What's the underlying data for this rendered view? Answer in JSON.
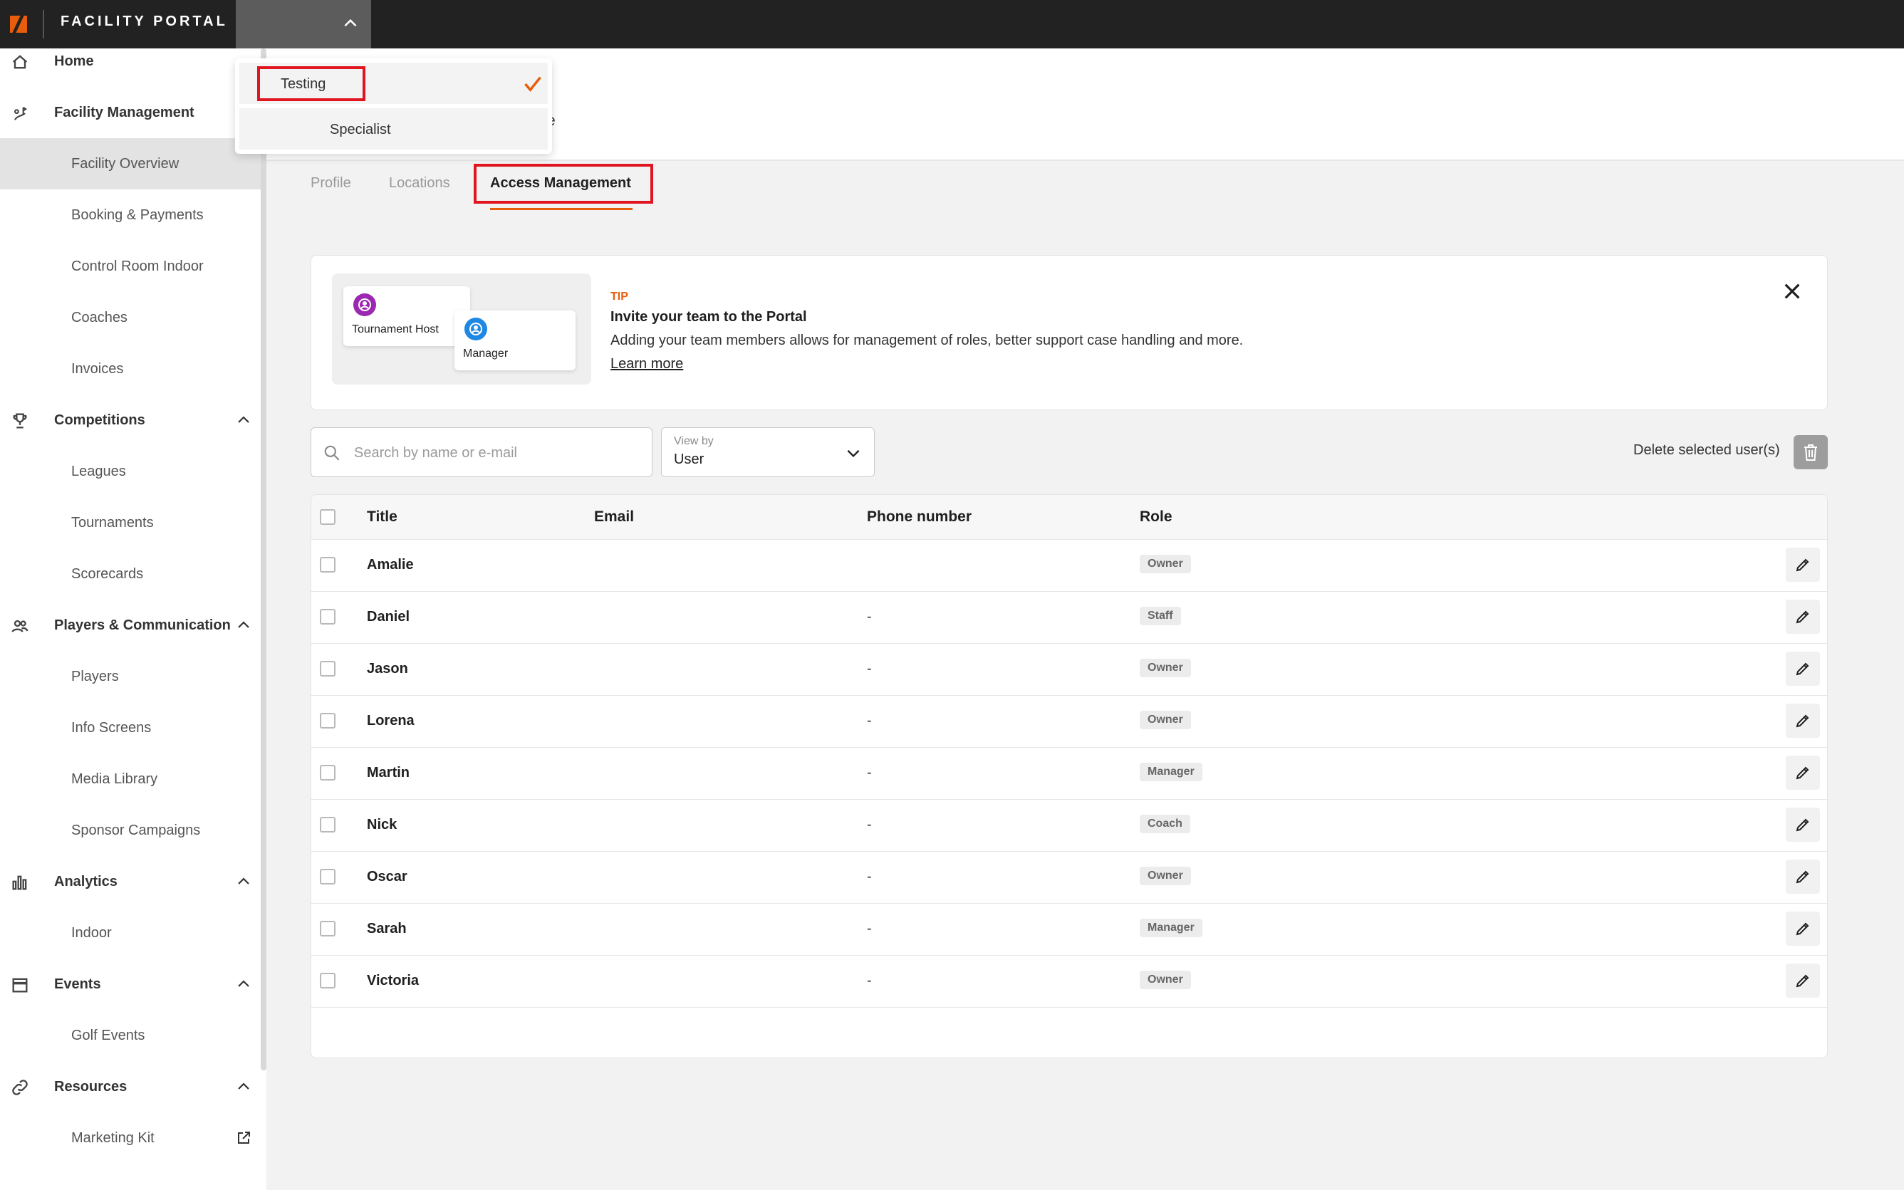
{
  "app": {
    "brand": "FACILITY PORTAL",
    "accent_color": "#e85d0c",
    "highlight_color": "#e0151f"
  },
  "facility_dropdown": {
    "items": [
      {
        "label": "Testing",
        "selected": true
      },
      {
        "label": "Specialist",
        "selected": false
      }
    ]
  },
  "sidebar": {
    "items": [
      {
        "label": "Home",
        "icon": "home-icon",
        "level": 0
      },
      {
        "label": "Facility Management",
        "icon": "facility-icon",
        "level": 0
      },
      {
        "label": "Facility Overview",
        "level": 1,
        "active": true
      },
      {
        "label": "Booking & Payments",
        "level": 1
      },
      {
        "label": "Control Room Indoor",
        "level": 1
      },
      {
        "label": "Coaches",
        "level": 1
      },
      {
        "label": "Invoices",
        "level": 1
      },
      {
        "label": "Competitions",
        "icon": "trophy-icon",
        "level": 0,
        "expanded": true
      },
      {
        "label": "Leagues",
        "level": 1
      },
      {
        "label": "Tournaments",
        "level": 1
      },
      {
        "label": "Scorecards",
        "level": 1
      },
      {
        "label": "Players & Communication",
        "icon": "people-icon",
        "level": 0,
        "expanded": true
      },
      {
        "label": "Players",
        "level": 1
      },
      {
        "label": "Info Screens",
        "level": 1
      },
      {
        "label": "Media Library",
        "level": 1
      },
      {
        "label": "Sponsor Campaigns",
        "level": 1
      },
      {
        "label": "Analytics",
        "icon": "bar-chart-icon",
        "level": 0,
        "expanded": true
      },
      {
        "label": "Indoor",
        "level": 1
      },
      {
        "label": "Events",
        "icon": "calendar-icon",
        "level": 0,
        "expanded": true
      },
      {
        "label": "Golf Events",
        "level": 1
      },
      {
        "label": "Resources",
        "icon": "link-icon",
        "level": 0,
        "expanded": true
      },
      {
        "label": "Marketing Kit",
        "level": 1,
        "external": true
      }
    ]
  },
  "header": {
    "partial_text": "e"
  },
  "tabs": [
    {
      "label": "Profile",
      "active": false
    },
    {
      "label": "Locations",
      "active": false
    },
    {
      "label": "Access Management",
      "active": true
    }
  ],
  "tip": {
    "kicker": "TIP",
    "title": "Invite your team to the Portal",
    "body": "Adding your team members allows for management of roles, better support case handling and more.",
    "link": "Learn more",
    "illustration": {
      "card1_label": "Tournament Host",
      "card1_color": "#9c27b0",
      "card2_label": "Manager",
      "card2_color": "#1e88e5"
    }
  },
  "toolbar": {
    "search_placeholder": "Search by name or e-mail",
    "view_by_caption": "View by",
    "view_by_value": "User",
    "delete_label": "Delete selected user(s)"
  },
  "table": {
    "columns": [
      "Title",
      "Email",
      "Phone number",
      "Role"
    ],
    "rows": [
      {
        "name": "Amalie",
        "email": "",
        "phone": "",
        "role": "Owner"
      },
      {
        "name": "Daniel",
        "email": "",
        "phone": "-",
        "role": "Staff"
      },
      {
        "name": "Jason",
        "email": "",
        "phone": "-",
        "role": "Owner"
      },
      {
        "name": "Lorena",
        "email": "",
        "phone": "-",
        "role": "Owner"
      },
      {
        "name": "Martin",
        "email": "",
        "phone": "-",
        "role": "Manager"
      },
      {
        "name": "Nick",
        "email": "",
        "phone": "-",
        "role": "Coach"
      },
      {
        "name": "Oscar",
        "email": "",
        "phone": "-",
        "role": "Owner"
      },
      {
        "name": "Sarah",
        "email": "",
        "phone": "-",
        "role": "Manager"
      },
      {
        "name": "Victoria",
        "email": "",
        "phone": "-",
        "role": "Owner"
      }
    ]
  }
}
